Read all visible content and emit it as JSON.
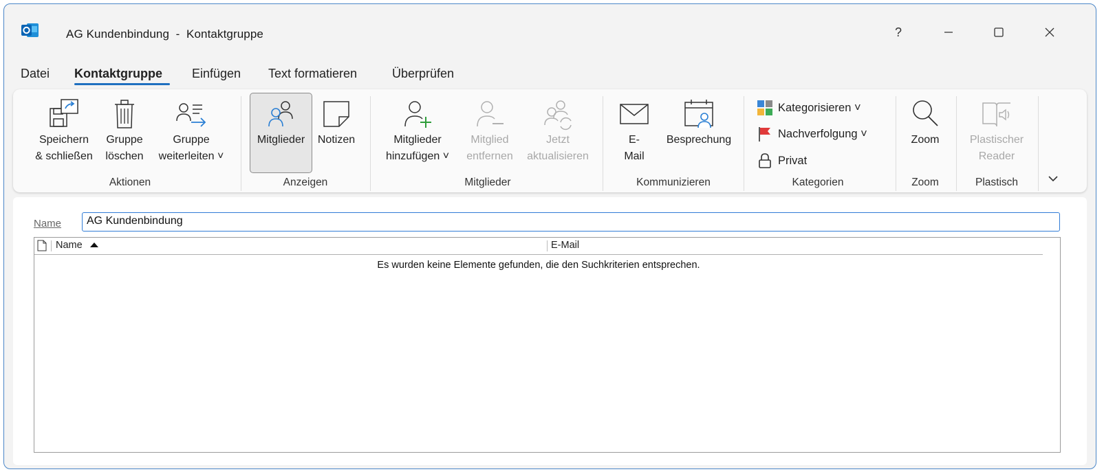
{
  "window": {
    "title": "AG Kundenbindung  -  Kontaktgruppe",
    "help": "?",
    "accent": "#1e6fbf"
  },
  "menu": {
    "tabs": [
      {
        "label": "Datei"
      },
      {
        "label": "Kontaktgruppe"
      },
      {
        "label": "Einfügen"
      },
      {
        "label": "Text formatieren"
      },
      {
        "label": "Überprüfen"
      }
    ]
  },
  "ribbon": {
    "groups": {
      "aktionen": {
        "label": "Aktionen",
        "save": {
          "line1": "Speichern",
          "line2": "& schließen"
        },
        "delete": {
          "line1": "Gruppe",
          "line2": "löschen"
        },
        "forward": {
          "line1": "Gruppe",
          "line2": "weiterleiten ˅"
        }
      },
      "anzeigen": {
        "label": "Anzeigen",
        "members": "Mitglieder",
        "notes": "Notizen"
      },
      "mitglieder": {
        "label": "Mitglieder",
        "add": {
          "line1": "Mitglieder",
          "line2": "hinzufügen ˅"
        },
        "remove": {
          "line1": "Mitglied",
          "line2": "entfernen"
        },
        "update": {
          "line1": "Jetzt",
          "line2": "aktualisieren"
        }
      },
      "kommunizieren": {
        "label": "Kommunizieren",
        "email": {
          "line1": "E-",
          "line2": "Mail"
        },
        "meeting": "Besprechung"
      },
      "kategorien": {
        "label": "Kategorien",
        "categorize": "Kategorisieren ˅",
        "followup": "Nachverfolgung ˅",
        "private": "Privat"
      },
      "zoom": {
        "label": "Zoom",
        "zoom": "Zoom"
      },
      "plastisch": {
        "label": "Plastisch",
        "reader": {
          "line1": "Plastischer",
          "line2": "Reader"
        }
      }
    }
  },
  "form": {
    "name_label": "Name",
    "name_value": "AG Kundenbindung",
    "table": {
      "col_name": "Name",
      "col_email": "E-Mail",
      "empty_message": "Es wurden keine Elemente gefunden, die den Suchkriterien entsprechen."
    }
  }
}
